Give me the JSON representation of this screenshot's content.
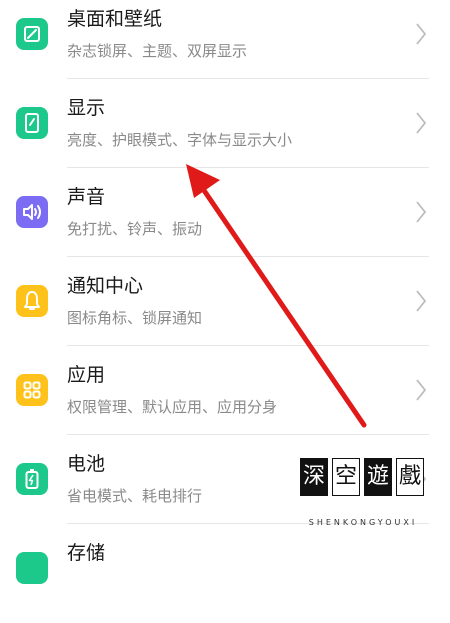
{
  "settings": {
    "items": [
      {
        "title": "桌面和壁纸",
        "subtitle": "杂志锁屏、主题、双屏显示",
        "icon": "wallpaper-icon",
        "color": "#1dc88b"
      },
      {
        "title": "显示",
        "subtitle": "亮度、护眼模式、字体与显示大小",
        "icon": "display-icon",
        "color": "#1dc88b"
      },
      {
        "title": "声音",
        "subtitle": "免打扰、铃声、振动",
        "icon": "sound-icon",
        "color": "#7b6cf3"
      },
      {
        "title": "通知中心",
        "subtitle": "图标角标、锁屏通知",
        "icon": "bell-icon",
        "color": "#ffc21a"
      },
      {
        "title": "应用",
        "subtitle": "权限管理、默认应用、应用分身",
        "icon": "apps-icon",
        "color": "#ffc21a"
      },
      {
        "title": "电池",
        "subtitle": "省电模式、耗电排行",
        "icon": "battery-icon",
        "color": "#1dc88b"
      },
      {
        "title": "存储",
        "subtitle": "",
        "icon": "storage-icon",
        "color": "#1dc88b"
      }
    ]
  },
  "annotation": {
    "arrow_color": "#e01919"
  },
  "watermark": {
    "chars": [
      "深",
      "空",
      "遊",
      "戲"
    ],
    "subtitle": "SHENKONGYOUXI"
  }
}
